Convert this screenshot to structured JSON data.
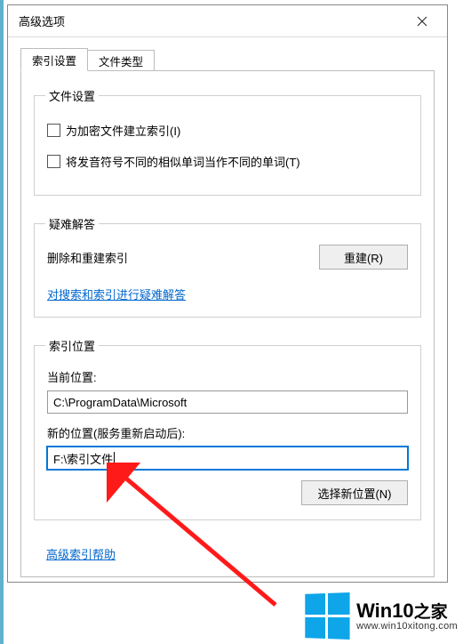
{
  "window": {
    "title": "高级选项"
  },
  "tabs": {
    "active": "索引设置",
    "inactive": "文件类型"
  },
  "file_settings": {
    "legend": "文件设置",
    "chk_encrypted": "为加密文件建立索引(I)",
    "chk_diacritics": "将发音符号不同的相似单词当作不同的单词(T)"
  },
  "troubleshoot": {
    "legend": "疑难解答",
    "delete_rebuild": "删除和重建索引",
    "rebuild_btn": "重建(R)",
    "link": "对搜索和索引进行疑难解答"
  },
  "index_location": {
    "legend": "索引位置",
    "current_label": "当前位置:",
    "current_value": "C:\\ProgramData\\Microsoft",
    "new_label": "新的位置(服务重新启动后):",
    "new_value": "F:\\索引文件",
    "select_btn": "选择新位置(N)"
  },
  "help_link": "高级索引帮助",
  "watermark": {
    "brand_en": "Win10",
    "brand_zh": "之家",
    "url": "www.win10xitong.com"
  }
}
